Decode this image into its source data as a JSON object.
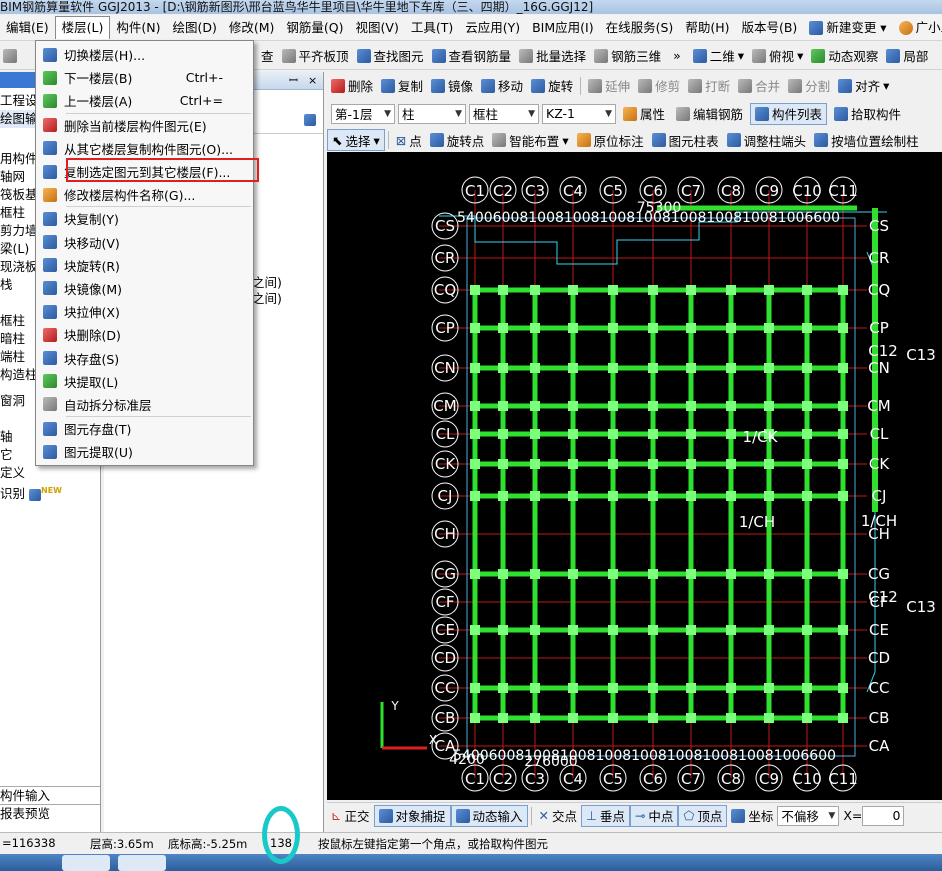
{
  "title_bar": {
    "text": "BIM钢筋算量软件 GGJ2013 - [D:\\钢筋新图形\\邢台蓝鸟华牛里项目\\华牛里地下车库（三、四期）_16G.GGJ12]"
  },
  "menubar": {
    "items": [
      "编辑(E)",
      "楼层(L)",
      "构件(N)",
      "绘图(D)",
      "修改(M)",
      "钢筋量(Q)",
      "视图(V)",
      "工具(T)",
      "云应用(Y)",
      "BIM应用(I)",
      "在线服务(S)",
      "帮助(H)",
      "版本号(B)",
      "新建变更",
      "广小二"
    ],
    "active": "楼层(L)"
  },
  "floor_menu": {
    "items": [
      {
        "label": "切换楼层(H)...",
        "shortcut": ""
      },
      {
        "label": "下一楼层(B)",
        "shortcut": "Ctrl+-"
      },
      {
        "label": "上一楼层(A)",
        "shortcut": "Ctrl+="
      },
      {
        "label": "删除当前楼层构件图元(E)",
        "shortcut": ""
      },
      {
        "label": "从其它楼层复制构件图元(O)...",
        "shortcut": ""
      },
      {
        "label": "复制选定图元到其它楼层(F)...",
        "shortcut": ""
      },
      {
        "label": "修改楼层构件名称(G)...",
        "shortcut": ""
      },
      {
        "label": "块复制(Y)",
        "shortcut": ""
      },
      {
        "label": "块移动(V)",
        "shortcut": ""
      },
      {
        "label": "块旋转(R)",
        "shortcut": ""
      },
      {
        "label": "块镜像(M)",
        "shortcut": ""
      },
      {
        "label": "块拉伸(X)",
        "shortcut": ""
      },
      {
        "label": "块删除(D)",
        "shortcut": ""
      },
      {
        "label": "块存盘(S)",
        "shortcut": ""
      },
      {
        "label": "块提取(L)",
        "shortcut": ""
      },
      {
        "label": "自动拆分标准层",
        "shortcut": ""
      },
      {
        "label": "图元存盘(T)",
        "shortcut": ""
      },
      {
        "label": "图元提取(U)",
        "shortcut": ""
      }
    ],
    "highlighted_item": "复制选定图元到其它楼层(F)..."
  },
  "toolbar1": {
    "items": [
      "查",
      "平齐板顶",
      "查找图元",
      "查看钢筋量",
      "批量选择",
      "钢筋三维",
      "二维",
      "俯视",
      "动态观察",
      "局部"
    ]
  },
  "toolbar2": {
    "items": [
      "删除",
      "复制",
      "镜像",
      "移动",
      "旋转",
      "延伸",
      "修剪",
      "打断",
      "合并",
      "分割",
      "对齐"
    ]
  },
  "toolbar3": {
    "floor": "第-1层",
    "type": "柱",
    "subtype": "框柱",
    "member": "KZ-1",
    "items": [
      "属性",
      "编辑钢筋",
      "构件列表",
      "拾取构件"
    ]
  },
  "toolbar4": {
    "items": [
      "选择",
      "点",
      "旋转点",
      "智能布置",
      "原位标注",
      "图元柱表",
      "调整柱端头",
      "按墙位置绘制柱"
    ]
  },
  "left_panel": {
    "rows": [
      "工程设置",
      "绘图输入",
      "用构件类",
      "轴网",
      "筏板基",
      "框柱",
      "剪力墙",
      "梁(L)",
      "现浇板",
      "栈",
      "框柱",
      "暗柱",
      "端柱",
      "构造柱",
      "窗洞",
      "轴",
      "它",
      "定义",
      "识别"
    ],
    "new_badge": "NEW",
    "bottom_tabs": [
      "构件输入",
      "报表预览"
    ]
  },
  "mid_panel": {
    "lines": [
      "之间)",
      "之间)"
    ]
  },
  "canvas": {
    "top_axis_labels": [
      "C1",
      "C2",
      "C3",
      "C4",
      "C5",
      "C6",
      "C7",
      "C8",
      "C9",
      "C10",
      "C11"
    ],
    "top_total": "75300",
    "top_dims": "5400600810081008100810081008100810081006600",
    "left_axis_labels": [
      "CS",
      "CR",
      "CQ",
      "CP",
      "CN",
      "CM",
      "CL",
      "CK",
      "CJ",
      "CH",
      "CG",
      "CF",
      "CE",
      "CD",
      "CC",
      "CB",
      "CA"
    ],
    "right_axis_labels": [
      "CS",
      "CR",
      "CQ",
      "CP",
      "CN",
      "CM",
      "CL",
      "CK",
      "CJ",
      "CH",
      "CG",
      "CF",
      "CE",
      "CD",
      "CC",
      "CB",
      "CA"
    ],
    "right_extra": [
      "C12",
      "C13",
      "C12",
      "C13"
    ],
    "bottom_total": "276000",
    "bottom_first": "4200",
    "bottom_dims": "5400600810081008100810081008100810081006600",
    "annotations": [
      "1/CH",
      "1/CH",
      "1/CK"
    ],
    "ucs": {
      "x": "X",
      "y": "Y"
    }
  },
  "snapbar": {
    "items": [
      "正交",
      "对象捕捉",
      "动态输入",
      "交点",
      "垂点",
      "中点",
      "顶点",
      "坐标"
    ],
    "offset_mode": "不偏移",
    "x_label": "X=",
    "x_value": "0"
  },
  "statusbar": {
    "coord": "=116338",
    "floor_height": "层高:3.65m",
    "base_height": "底标高:-5.25m",
    "count": "138",
    "hint": "按鼠标左键指定第一个角点，或拾取构件图元"
  },
  "colors": {
    "accent_blue": "#3a78d4",
    "highlight_red": "#e02020",
    "ring_cyan": "#19c9c9",
    "beam_green": "#2fe02f"
  }
}
